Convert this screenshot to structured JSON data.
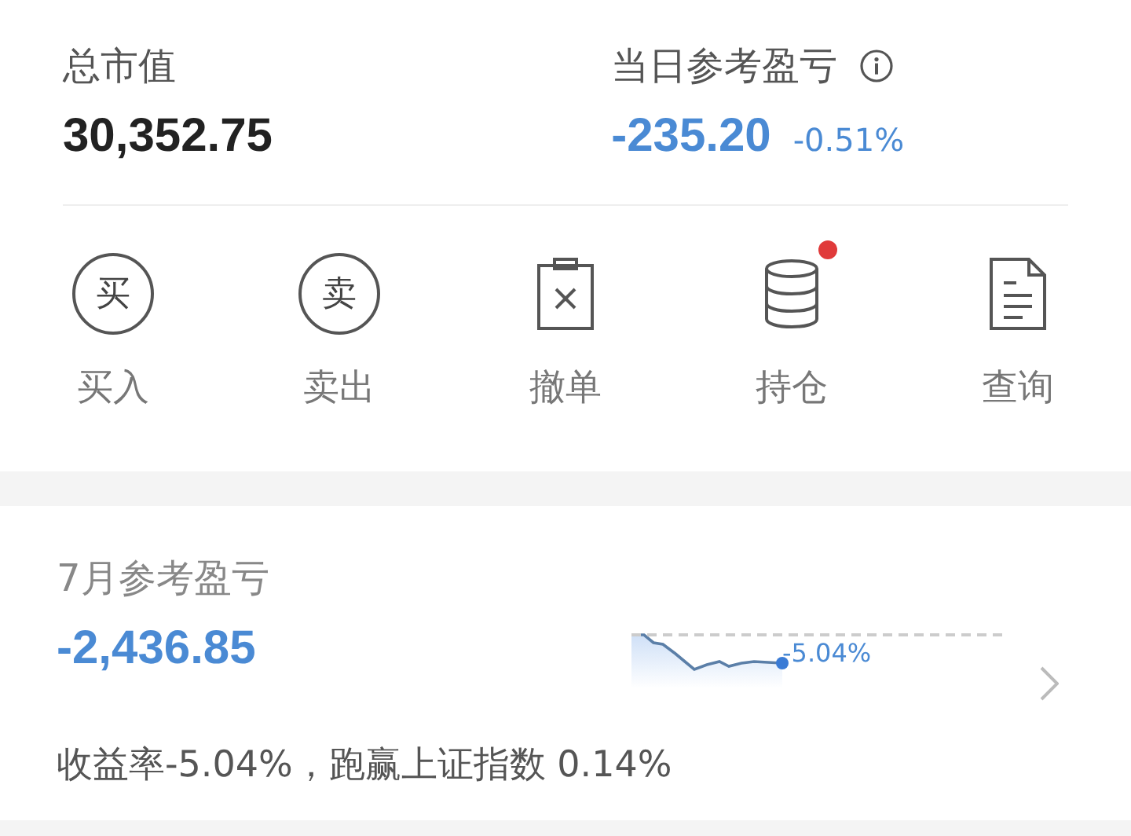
{
  "summary": {
    "market_value": {
      "label": "总市值",
      "value": "30,352.75"
    },
    "daily_pnl": {
      "label": "当日参考盈亏",
      "value": "-235.20",
      "percent": "-0.51%"
    }
  },
  "actions": [
    {
      "label": "买入",
      "kind": "circle",
      "glyph": "买",
      "badge": false
    },
    {
      "label": "卖出",
      "kind": "circle",
      "glyph": "卖",
      "badge": false
    },
    {
      "label": "撤单",
      "kind": "cancel",
      "badge": false
    },
    {
      "label": "持仓",
      "kind": "database",
      "badge": true
    },
    {
      "label": "查询",
      "kind": "document",
      "badge": false
    }
  ],
  "monthly": {
    "title": "7月参考盈亏",
    "value": "-2,436.85",
    "sparkline_label": "-5.04%",
    "note": "收益率-5.04%，跑赢上证指数 0.14%"
  }
}
